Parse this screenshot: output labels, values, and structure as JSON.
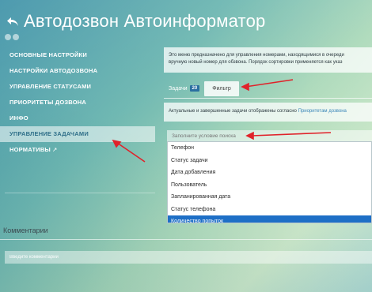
{
  "header": {
    "title": "Автодозвон Автоинформатор"
  },
  "sidebar": {
    "items": [
      {
        "label": "ОСНОВНЫЕ НАСТРОЙКИ"
      },
      {
        "label": "НАСТРОЙКИ АВТОДОЗВОНА"
      },
      {
        "label": "УПРАВЛЕНИЕ СТАТУСАМИ"
      },
      {
        "label": "ПРИОРИТЕТЫ ДОЗВОНА"
      },
      {
        "label": "ИНФО"
      },
      {
        "label": "УПРАВЛЕНИЕ ЗАДАЧАМИ"
      },
      {
        "label": "НОРМАТИВЫ"
      }
    ]
  },
  "main": {
    "info_line1": "Это меню предназначено для управления номерами, находящимися в очереди",
    "info_line2": "вручную новый номер для обзвона. Порядок сортировки применяется как указ",
    "tabs": {
      "tasks_label": "Задачи",
      "tasks_count": "20",
      "filter_label": "Фильтр"
    },
    "note": {
      "text": "Актуальные и завершенные задачи отображены согласно ",
      "link": "Приоритетам дозвона"
    },
    "search": {
      "placeholder": "Заполните условие поиска",
      "options": [
        "Телефон",
        "Статус задачи",
        "Дата добавления",
        "Пользователь",
        "Запланированная дата",
        "Статус телефона",
        "Количество попыток"
      ]
    }
  },
  "comments": {
    "label": "Комментарии",
    "placeholder": "Введите комментарий"
  },
  "colors": {
    "accent": "#1e6fc6",
    "arrow": "#e0222a",
    "active_text": "#2f6f89"
  }
}
